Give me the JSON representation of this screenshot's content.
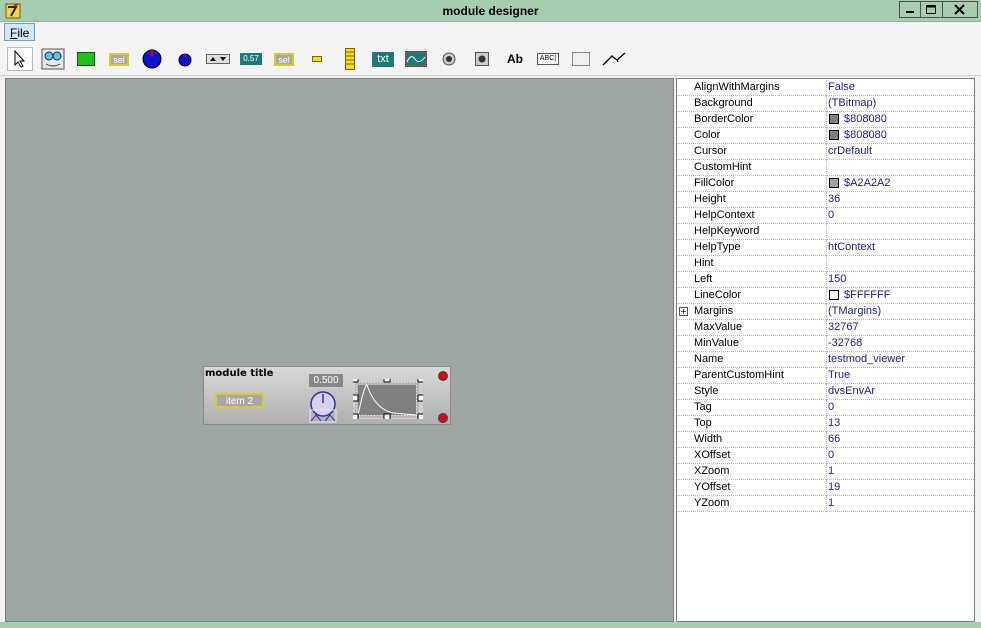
{
  "window": {
    "title": "module designer"
  },
  "menu": {
    "file_mnemonic": "F",
    "file_rest": "ile"
  },
  "toolbar": {
    "tools": [
      {
        "name": "pointer-tool",
        "kind": "pointer"
      },
      {
        "name": "face-tool",
        "kind": "face"
      },
      {
        "name": "panel-tool",
        "kind": "panel"
      },
      {
        "name": "selector-tool",
        "kind": "sel",
        "text": "sel"
      },
      {
        "name": "knob-tool",
        "kind": "knob"
      },
      {
        "name": "small-knob-tool",
        "kind": "smallknob"
      },
      {
        "name": "updown-tool",
        "kind": "updown"
      },
      {
        "name": "numeric-display-tool",
        "kind": "num",
        "text": "0.57"
      },
      {
        "name": "selector2-tool",
        "kind": "sel2",
        "text": "sel"
      },
      {
        "name": "led-tool",
        "kind": "led"
      },
      {
        "name": "slider-tool",
        "kind": "slider"
      },
      {
        "name": "text-tool",
        "kind": "txt",
        "text": "txt"
      },
      {
        "name": "graph-tool",
        "kind": "graph"
      },
      {
        "name": "button-tool",
        "kind": "button"
      },
      {
        "name": "button2-tool",
        "kind": "button2"
      },
      {
        "name": "label-tool",
        "kind": "label",
        "text": "Ab"
      },
      {
        "name": "edit-tool",
        "kind": "edit",
        "text": "ABC|"
      },
      {
        "name": "box-tool",
        "kind": "box"
      },
      {
        "name": "line-tool",
        "kind": "line"
      }
    ]
  },
  "module": {
    "title": "module title",
    "item_label": "item 2",
    "value_display": "0.500"
  },
  "colors": {
    "titlebar": "#a6cdb0",
    "canvas": "#9ea6a3",
    "value_text": "#1b1b8c"
  },
  "properties": [
    {
      "name": "AlignWithMargins",
      "value": "False"
    },
    {
      "name": "Background",
      "value": "(TBitmap)"
    },
    {
      "name": "BorderColor",
      "value": "$808080",
      "swatch": "#808080"
    },
    {
      "name": "Color",
      "value": "$808080",
      "swatch": "#808080"
    },
    {
      "name": "Cursor",
      "value": "crDefault"
    },
    {
      "name": "CustomHint",
      "value": ""
    },
    {
      "name": "FillColor",
      "value": "$A2A2A2",
      "swatch": "#a2a2a2"
    },
    {
      "name": "Height",
      "value": "36"
    },
    {
      "name": "HelpContext",
      "value": "0"
    },
    {
      "name": "HelpKeyword",
      "value": ""
    },
    {
      "name": "HelpType",
      "value": "htContext"
    },
    {
      "name": "Hint",
      "value": ""
    },
    {
      "name": "Left",
      "value": "150"
    },
    {
      "name": "LineColor",
      "value": "$FFFFFF",
      "swatch": "#ffffff"
    },
    {
      "name": "Margins",
      "value": "(TMargins)",
      "expandable": true
    },
    {
      "name": "MaxValue",
      "value": "32767"
    },
    {
      "name": "MinValue",
      "value": "-32768"
    },
    {
      "name": "Name",
      "value": "testmod_viewer"
    },
    {
      "name": "ParentCustomHint",
      "value": "True"
    },
    {
      "name": "Style",
      "value": "dvsEnvAr"
    },
    {
      "name": "Tag",
      "value": "0"
    },
    {
      "name": "Top",
      "value": "13"
    },
    {
      "name": "Width",
      "value": "66"
    },
    {
      "name": "XOffset",
      "value": "0"
    },
    {
      "name": "XZoom",
      "value": "1"
    },
    {
      "name": "YOffset",
      "value": "19"
    },
    {
      "name": "YZoom",
      "value": "1"
    }
  ]
}
